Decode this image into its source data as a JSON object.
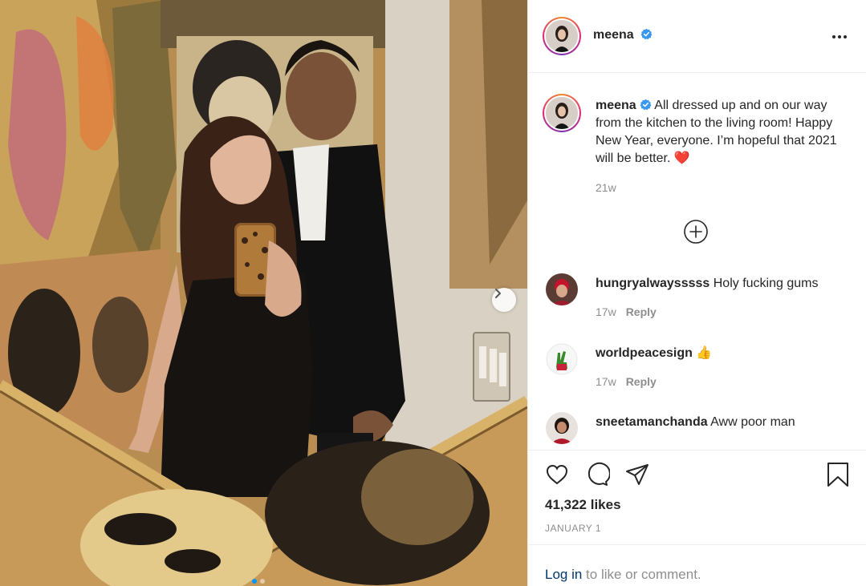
{
  "post": {
    "author": "meena",
    "verified": true,
    "caption": "All dressed up and on our way from the kitchen to the living room! Happy New Year, everyone. I’m hopeful that 2021 will be better. ❤️",
    "caption_age": "21w",
    "likes": "41,322 likes",
    "date": "JANUARY 1",
    "carousel": {
      "slide_count": 2,
      "current_slide": 1
    }
  },
  "header": {
    "avatar_icon": "profile-avatar",
    "more_icon": "more-options-icon"
  },
  "comments": [
    {
      "username": "hungryalwaysssss",
      "text": "Holy fucking gums",
      "age": "17w",
      "reply_label": "Reply"
    },
    {
      "username": "worldpeacesign",
      "text": "👍",
      "age": "17w",
      "reply_label": "Reply"
    },
    {
      "username": "sneetamanchanda",
      "text": "Aww poor man"
    }
  ],
  "actions": {
    "like_icon": "heart-icon",
    "comment_icon": "comment-icon",
    "share_icon": "share-icon",
    "save_icon": "bookmark-icon",
    "load_more_icon": "plus-circle-icon"
  },
  "login": {
    "link_label": "Log in",
    "suffix": " to like or comment."
  },
  "colors": {
    "link": "#00376b",
    "verified": "#3897f0",
    "heart": "#ed4956",
    "muted": "#8e8e8e",
    "carousel_active": "#0095f6"
  }
}
